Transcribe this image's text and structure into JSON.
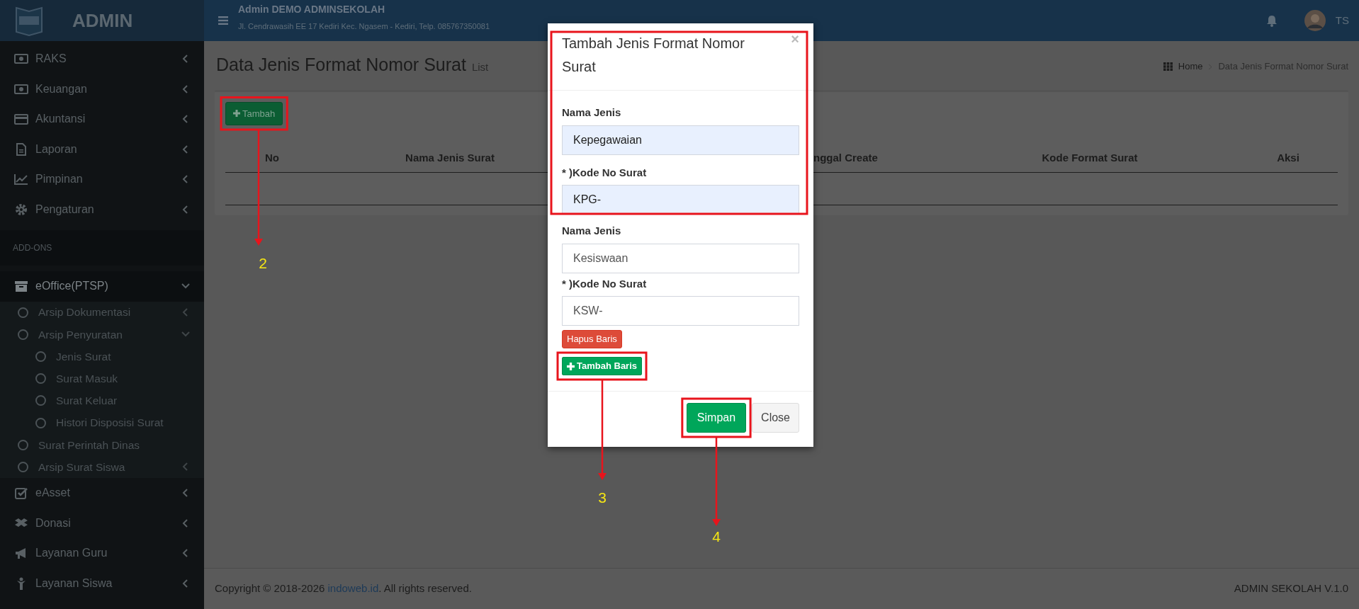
{
  "topbar": {
    "brand": "ADMIN",
    "title": "Admin DEMO ADMINSEKOLAH",
    "address": "Jl. Cendrawasih EE 17 Kediri Kec. Ngasem - Kediri, Telp. 085767350081",
    "user": "TS"
  },
  "sidebar": {
    "items": [
      {
        "label": "RAKS",
        "kind": "group",
        "expanded": false
      },
      {
        "label": "Keuangan",
        "kind": "group",
        "expanded": false
      },
      {
        "label": "Akuntansi",
        "kind": "group",
        "expanded": false
      },
      {
        "label": "Laporan",
        "kind": "group",
        "expanded": false
      },
      {
        "label": "Pimpinan",
        "kind": "group",
        "expanded": false
      },
      {
        "label": "Pengaturan",
        "kind": "group",
        "expanded": false
      }
    ],
    "section_label": "ADD-ONS",
    "addon_items": [
      {
        "label": "eOffice(PTSP)",
        "kind": "group",
        "expanded": true,
        "children": [
          {
            "label": "Arsip Dokumentasi",
            "kind": "group",
            "expanded": false
          },
          {
            "label": "Arsip Penyuratan",
            "kind": "group",
            "expanded": true,
            "children": [
              {
                "label": "Jenis Surat",
                "kind": "link"
              },
              {
                "label": "Surat Masuk",
                "kind": "link"
              },
              {
                "label": "Surat Keluar",
                "kind": "link"
              },
              {
                "label": "Histori Disposisi Surat",
                "kind": "link"
              }
            ]
          },
          {
            "label": "Surat Perintah Dinas",
            "kind": "link"
          },
          {
            "label": "Arsip Surat Siswa",
            "kind": "group",
            "expanded": false
          }
        ]
      },
      {
        "label": "eAsset",
        "kind": "group",
        "expanded": false
      },
      {
        "label": "Donasi",
        "kind": "group",
        "expanded": false
      },
      {
        "label": "Layanan Guru",
        "kind": "group",
        "expanded": false
      },
      {
        "label": "Layanan Siswa",
        "kind": "group",
        "expanded": false
      }
    ]
  },
  "page": {
    "title": "Data Jenis Format Nomor Surat",
    "subtitle": "List",
    "breadcrumb": [
      "Home",
      "Data Jenis Format Nomor Surat"
    ],
    "add_button": "Tambah",
    "table": {
      "columns": [
        "No",
        "Nama Jenis Surat",
        "nggal Create",
        "Kode Format Surat",
        "Aksi"
      ]
    }
  },
  "modal": {
    "title": "Tambah Jenis Format Nomor Surat",
    "close": "×",
    "rows": [
      {
        "name_label": "Nama Jenis",
        "name_value": "Kepegawaian",
        "code_label": "* )Kode No Surat",
        "code_value": "KPG-",
        "autofilled": true
      },
      {
        "name_label": "Nama Jenis",
        "name_value": "Kesiswaan",
        "code_label": "* )Kode No Surat",
        "code_value": "KSW-",
        "autofilled": false,
        "remove_label": "Hapus Baris"
      }
    ],
    "add_row_button": "Tambah Baris",
    "save_button": "Simpan",
    "close_button": "Close"
  },
  "callouts": [
    {
      "number": "2"
    },
    {
      "number": "3"
    },
    {
      "number": "4"
    }
  ],
  "footer": {
    "copyright_prefix": "Copyright © 2018-2026 ",
    "link": "indoweb.id",
    "copyright_suffix": ". All rights reserved.",
    "version": "ADMIN SEKOLAH V.1.0"
  }
}
